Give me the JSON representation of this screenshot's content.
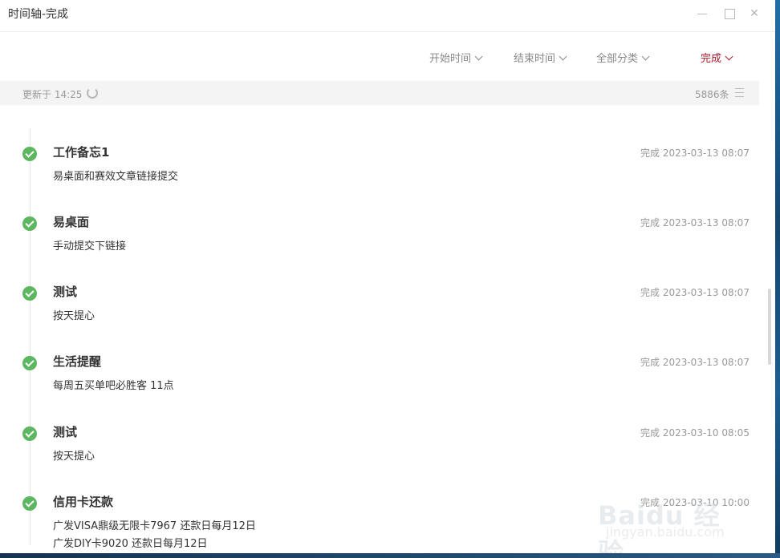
{
  "window": {
    "title": "时间轴-完成"
  },
  "filters": [
    {
      "label": "开始时间"
    },
    {
      "label": "结束时间"
    },
    {
      "label": "全部分类"
    },
    {
      "label": "完成"
    }
  ],
  "status": {
    "updated": "更新于 14:25",
    "count": "5886条"
  },
  "entries": [
    {
      "title": "工作备忘1",
      "meta": "完成 2023-03-13 08:07",
      "desc": "易桌面和赛效文章链接提交",
      "desc2": ""
    },
    {
      "title": "易桌面",
      "meta": "完成 2023-03-13 08:07",
      "desc": "手动提交下链接",
      "desc2": ""
    },
    {
      "title": "测试",
      "meta": "完成 2023-03-13 08:07",
      "desc": "按天提心",
      "desc2": ""
    },
    {
      "title": "生活提醒",
      "meta": "完成 2023-03-13 08:07",
      "desc": "每周五买单吧必胜客  11点",
      "desc2": ""
    },
    {
      "title": "测试",
      "meta": "完成 2023-03-10 08:05",
      "desc": "按天提心",
      "desc2": ""
    },
    {
      "title": "信用卡还款",
      "meta": "完成 2023-03-10 10:00",
      "desc": "广发VISA鼎级无限卡7967 还款日每月12日",
      "desc2": "广发DIY卡9020     还款日每月12日"
    }
  ],
  "watermark": {
    "text": "Baidu 经验",
    "url": "jingyan.baidu.com"
  },
  "colors": {
    "accent": "#a8192a",
    "check": "#5db761"
  }
}
